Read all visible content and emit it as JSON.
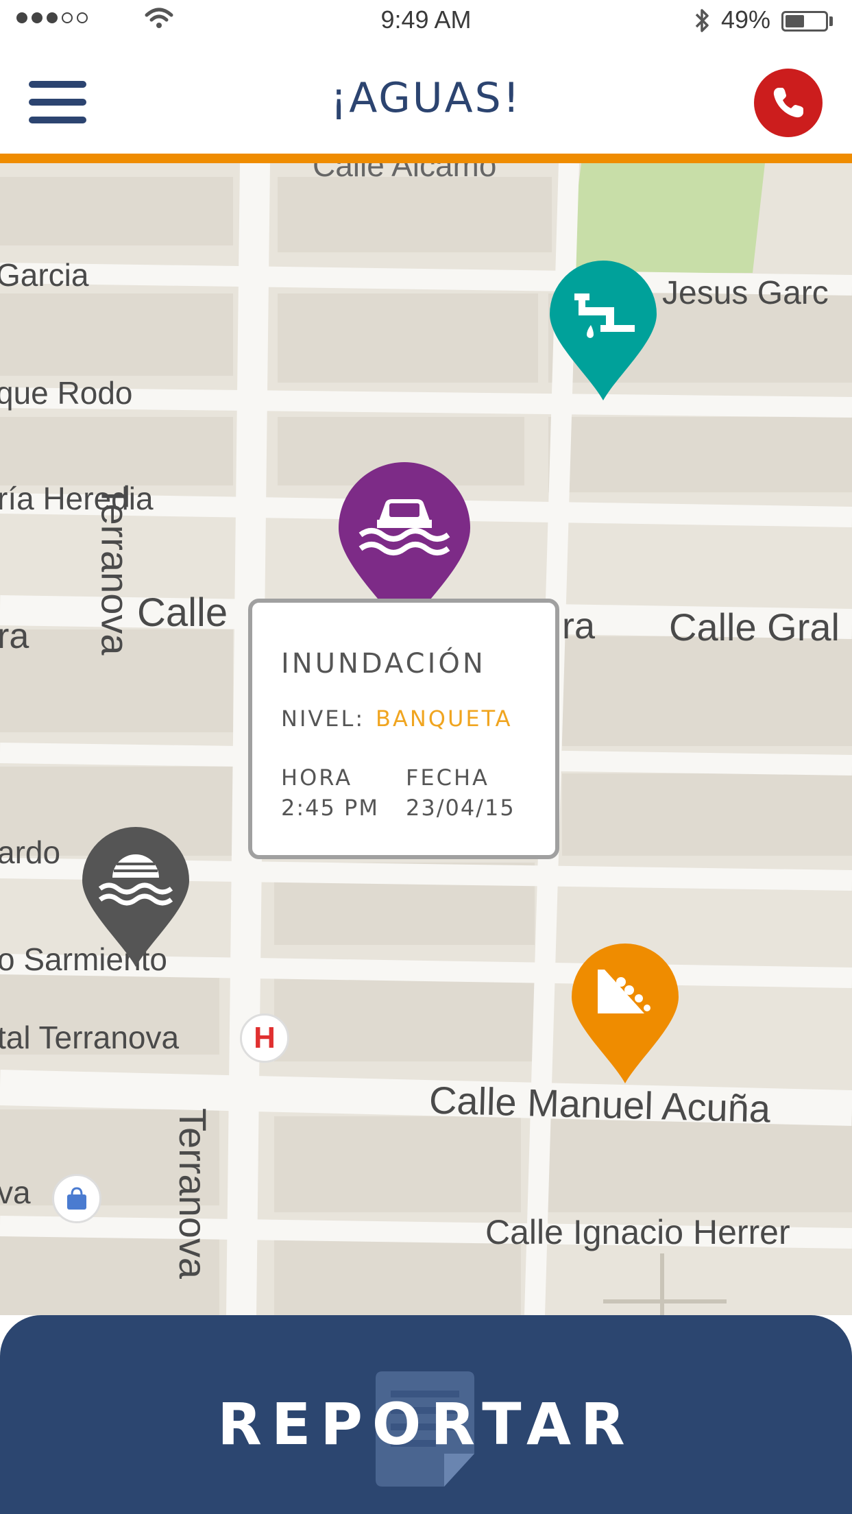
{
  "status_bar": {
    "time": "9:49 AM",
    "battery": "49%",
    "battery_level": 0.49
  },
  "header": {
    "title": "¡AGUAS!",
    "menu_icon": "hamburger-menu-icon",
    "call_icon": "phone-icon"
  },
  "colors": {
    "brand_blue": "#2c4470",
    "accent_orange": "#ef8c00",
    "call_red": "#cc1d1d",
    "flood_purple": "#7d2b87",
    "leak_teal": "#00a19a",
    "landslide_orange": "#ef8c00",
    "overflow_gray": "#555555",
    "level_yellow": "#f0a520"
  },
  "map": {
    "streets": {
      "alcamo": "Calle Alcamo",
      "garcia": "Garcia",
      "jesus_garcia": "Jesus Garc",
      "rodo": "que Rodo",
      "heredia": "ría Heredia",
      "calle_left": "Calle",
      "ra_left": "ra",
      "ra_mid": "ra",
      "calle_gral": "Calle Gral",
      "terranova_top": "Terranova",
      "ardo": "ardo",
      "sarmiento": "o Sarmiento",
      "tal_terranova": "tal Terranova",
      "manuel_acuna": "Calle Manuel Acuña",
      "va": "va",
      "terranova_bottom": "Terranova",
      "ignacio_herrer": "Calle Ignacio Herrer"
    },
    "hospital_letter": "H",
    "pins": [
      {
        "type": "water-leak",
        "icon": "faucet-leak-icon"
      },
      {
        "type": "flood",
        "icon": "car-flood-icon"
      },
      {
        "type": "drain-overflow",
        "icon": "sewer-overflow-icon"
      },
      {
        "type": "landslide",
        "icon": "landslide-icon"
      }
    ]
  },
  "popup": {
    "title": "INUNDACIÓN",
    "level_label": "NIVEL:",
    "level_value": "BANQUETA",
    "hour_label": "HORA",
    "hour_value": "2:45 PM",
    "date_label": "FECHA",
    "date_value": "23/04/15"
  },
  "report": {
    "label": "REPORTAR",
    "icon": "document-icon"
  }
}
